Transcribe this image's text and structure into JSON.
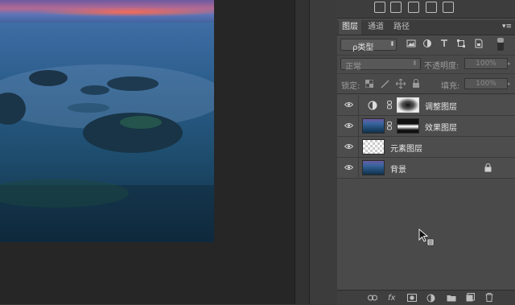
{
  "panel": {
    "tabs": [
      {
        "label": "图层",
        "active": true
      },
      {
        "label": "通道",
        "active": false
      },
      {
        "label": "路径",
        "active": false
      }
    ],
    "filter": {
      "label": "ρ类型",
      "icons": [
        "image-filter-icon",
        "adjustment-filter-icon",
        "type-filter-icon",
        "shape-filter-icon",
        "smart-object-filter-icon"
      ]
    },
    "blend": {
      "mode": "正常",
      "opacity_label": "不透明度:",
      "opacity_value": "100%"
    },
    "lock": {
      "label": "锁定:",
      "fill_label": "填充:",
      "fill_value": "100%"
    },
    "layers": [
      {
        "name": "调整图层",
        "type": "adjustment",
        "visible": true
      },
      {
        "name": "效果图层",
        "type": "image-with-mask",
        "visible": true
      },
      {
        "name": "元素图层",
        "type": "transparent",
        "visible": true
      },
      {
        "name": "背景",
        "type": "background",
        "visible": true,
        "locked": true
      }
    ],
    "bottom_icons": [
      "link-icon",
      "fx-icon",
      "mask-icon",
      "adjustment-icon",
      "folder-icon",
      "new-layer-icon",
      "trash-icon"
    ],
    "bottom_labels": {
      "fx": "fx"
    }
  },
  "colors": {
    "panel_bg": "#4a4a4a",
    "canvas_bg": "#262626",
    "accent": "#2d6fb0"
  }
}
